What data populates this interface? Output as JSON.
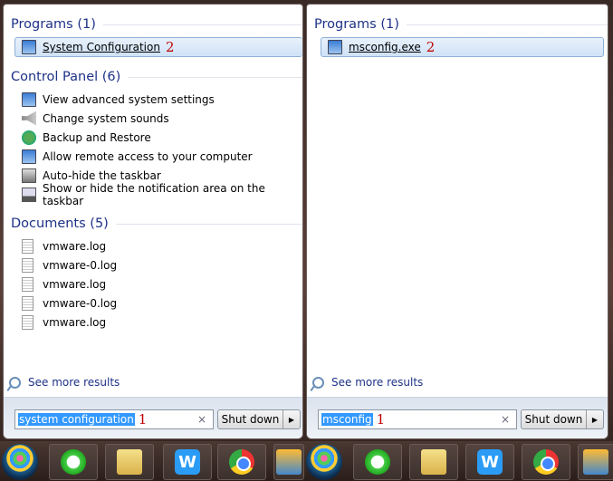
{
  "left": {
    "programs_header": "Programs (1)",
    "programs": [
      {
        "label": "System Configuration",
        "annotation": "2",
        "icon": "system-config-icon"
      }
    ],
    "control_panel_header": "Control Panel (6)",
    "control_panel": [
      {
        "label": "View advanced system settings",
        "icon": "monitor-icon"
      },
      {
        "label": "Change system sounds",
        "icon": "speaker-icon"
      },
      {
        "label": "Backup and Restore",
        "icon": "backup-icon"
      },
      {
        "label": "Allow remote access to your computer",
        "icon": "monitor-icon"
      },
      {
        "label": "Auto-hide the taskbar",
        "icon": "taskbar-icon"
      },
      {
        "label": "Show or hide the notification area on the taskbar",
        "icon": "laptop-icon"
      }
    ],
    "documents_header": "Documents (5)",
    "documents": [
      "vmware.log",
      "vmware-0.log",
      "vmware.log",
      "vmware-0.log",
      "vmware.log"
    ],
    "see_more": "See more results",
    "search_value": "system configuration",
    "search_annotation": "1",
    "clear": "×",
    "shutdown": "Shut down",
    "arrow": "▶"
  },
  "right": {
    "programs_header": "Programs (1)",
    "programs": [
      {
        "label": "msconfig.exe",
        "annotation": "2",
        "icon": "system-config-icon"
      }
    ],
    "see_more": "See more results",
    "search_value": "msconfig",
    "search_annotation": "1",
    "clear": "×",
    "shutdown": "Shut down",
    "arrow": "▶"
  },
  "taskbar": {
    "apps": [
      "start-orb",
      "internet-explorer",
      "file-explorer",
      "wps",
      "chrome",
      "vmware"
    ],
    "wps_letter": "W"
  },
  "colors": {
    "header": "#1e3287",
    "selection": "#3399ff",
    "annotation": "#c00000"
  }
}
